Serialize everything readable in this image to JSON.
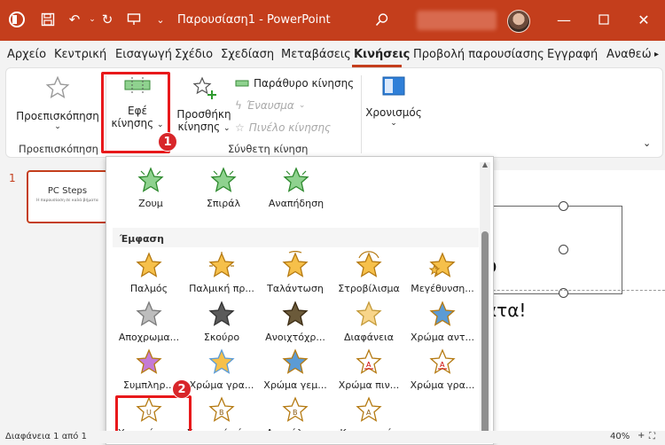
{
  "window": {
    "title": "Παρουσίαση1 - PowerPoint",
    "accent": "#c43e1c"
  },
  "tabs": [
    "Αρχείο",
    "Κεντρική",
    "Εισαγωγή",
    "Σχέδιο",
    "Σχεδίαση",
    "Μεταβάσεις",
    "Κινήσεις",
    "Προβολή παρουσίασης",
    "Εγγραφή",
    "Αναθεώ"
  ],
  "active_tab": "Κινήσεις",
  "ribbon": {
    "preview_label": "Προεπισκόπηση",
    "preview_group": "Προεπισκόπηση",
    "effects_label_1": "Εφέ",
    "effects_label_2": "κίνησης",
    "add_label_1": "Προσθήκη",
    "add_label_2": "κίνησης",
    "animation_pane": "Παράθυρο κίνησης",
    "trigger": "Έναυσμα",
    "painter": "Πινέλο κίνησης",
    "advanced_group": "Σύνθετη κίνηση",
    "timing_label": "Χρονισμός"
  },
  "callouts": {
    "one": "1",
    "two": "2"
  },
  "thumbnail": {
    "number": "1",
    "title": "PC Steps",
    "subtitle": "Η παρουσίαση σε καλά βήματα"
  },
  "slide": {
    "fragment_1": "ο",
    "fragment_2": "ατα!"
  },
  "gallery": {
    "top_row": [
      {
        "label": "Ζουμ",
        "icon": "zoom-star-icon"
      },
      {
        "label": "Σπιράλ",
        "icon": "spiral-star-icon"
      },
      {
        "label": "Αναπήδηση",
        "icon": "bounce-star-icon"
      }
    ],
    "section_title": "Έμφαση",
    "rows": [
      [
        "Παλμός",
        "Παλμική πρ...",
        "Ταλάντωση",
        "Στροβίλισμα",
        "Μεγέθυνση..."
      ],
      [
        "Αποχρωμα...",
        "Σκούρο",
        "Ανοιχτόχρ...",
        "Διαφάνεια",
        "Χρώμα αντ..."
      ],
      [
        "Συμπληρ...",
        "Χρώμα γρα...",
        "Χρώμα γεμ...",
        "Χρώμα πιν...",
        "Χρώμα γρα..."
      ],
      [
        "Υπογράμμι...",
        "Στιγμιαία έν...",
        "Αποκάλυψ...",
        "Κυματισμός"
      ]
    ]
  },
  "status": {
    "slide_info": "Διαφάνεια 1 από 1",
    "zoom": "40%"
  }
}
